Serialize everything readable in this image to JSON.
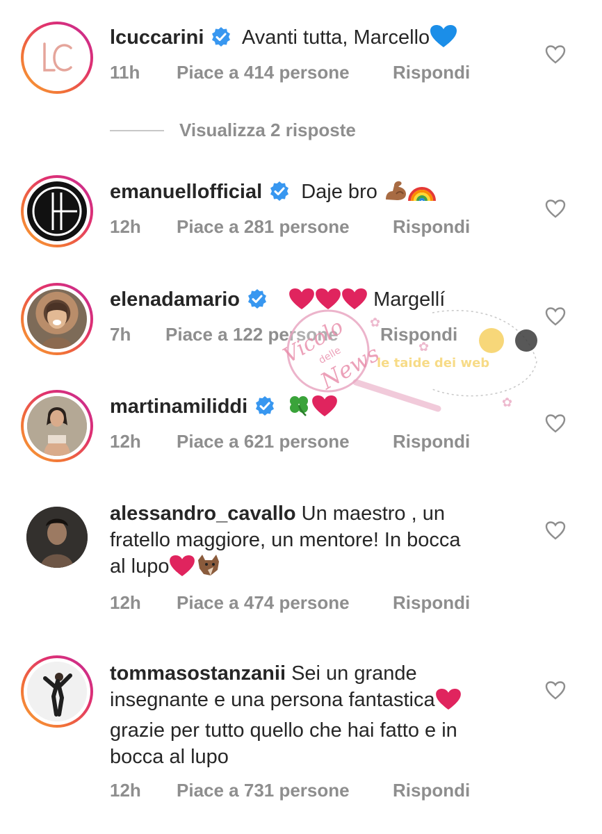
{
  "comments": [
    {
      "username": "lcuccarini",
      "verified": true,
      "text": "Avanti tutta, Marcello",
      "time": "11h",
      "likes": "Piace a 414 persone",
      "reply_label": "Rispondi",
      "avatar_monogram": "LC",
      "emojis": [
        "blue-heart"
      ]
    },
    {
      "username": "emanuellofficial",
      "verified": true,
      "text": "Daje bro",
      "time": "12h",
      "likes": "Piace a 281 persone",
      "reply_label": "Rispondi",
      "emojis": [
        "flexed-biceps",
        "rainbow"
      ]
    },
    {
      "username": "elenadamario",
      "verified": true,
      "text": "Margellí",
      "time": "7h",
      "likes": "Piace a 122 persone",
      "reply_label": "Rispondi",
      "emojis": [
        "red-heart",
        "red-heart",
        "red-heart"
      ]
    },
    {
      "username": "martinamiliddi",
      "verified": true,
      "text": "",
      "time": "12h",
      "likes": "Piace a 621 persone",
      "reply_label": "Rispondi",
      "emojis": [
        "four-leaf-clover",
        "red-heart"
      ]
    },
    {
      "username": "alessandro_cavallo",
      "verified": false,
      "text_lines": [
        "Un maestro , un",
        "fratello maggiore, un mentore! In bocca",
        "al lupo"
      ],
      "time": "12h",
      "likes": "Piace a 474 persone",
      "reply_label": "Rispondi",
      "emojis": [
        "red-heart",
        "wolf"
      ]
    },
    {
      "username": "tommasostanzanii",
      "verified": false,
      "text_lines": [
        "Sei un grande",
        "insegnante e una persona fantastica",
        "grazie per tutto quello che hai fatto e in",
        "bocca al lupo"
      ],
      "time": "12h",
      "likes": "Piace a 731 persone",
      "reply_label": "Rispondi",
      "emojis": [
        "red-heart"
      ]
    }
  ],
  "view_replies": "Visualizza 2 risposte",
  "watermark": {
    "line1": "Vicolo",
    "line2": "delle",
    "line3": "News",
    "banner": "le taide dei web"
  },
  "colors": {
    "text": "#262626",
    "meta": "#8e8e8e",
    "verified": "#3897f0",
    "heart_red": "#e0245e",
    "blue_heart": "#1b8ee8",
    "watermark_pink": "#e88aa8"
  }
}
